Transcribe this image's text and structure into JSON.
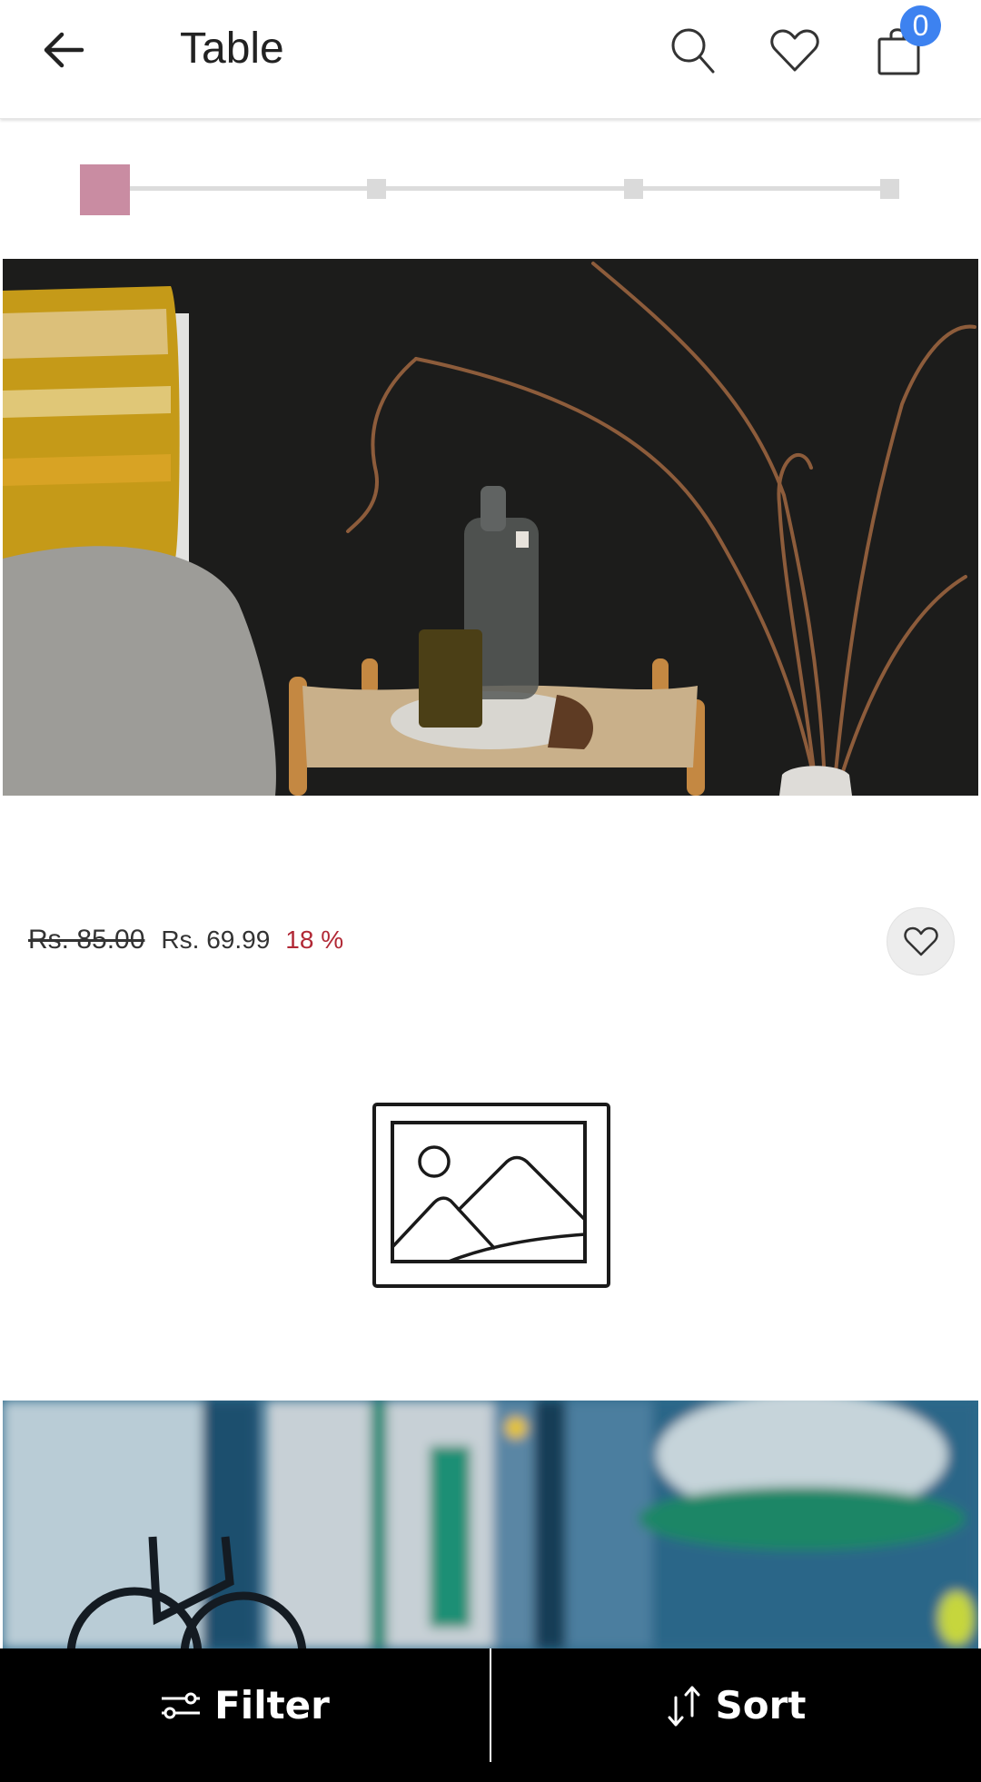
{
  "header": {
    "title": "Table",
    "back_icon": "arrow-left-icon",
    "search_icon": "search-icon",
    "wishlist_icon": "heart-icon",
    "cart_icon": "shopping-bag-icon",
    "cart_count": "0",
    "badge_color": "#3d82f0"
  },
  "image_slider": {
    "total_steps": 4,
    "current_step": 1,
    "active_color": "#c98ca2"
  },
  "product": {
    "image_description": "Bedside stool with glass bottle, amber glass, yellow pillow, gray blanket and dried branches against a dark wall",
    "original_price": "Rs. 85.00",
    "sale_price": "Rs. 69.99",
    "discount": "18 %",
    "discount_color": "#b12835",
    "wishlist_icon": "heart-icon"
  },
  "next_product": {
    "placeholder_icon": "image-placeholder-icon",
    "image_description": "Blurred graffiti wall with a bicycle"
  },
  "bottom_bar": {
    "filter_label": "Filter",
    "filter_icon": "sliders-icon",
    "sort_label": "Sort",
    "sort_icon": "sort-arrows-icon"
  }
}
